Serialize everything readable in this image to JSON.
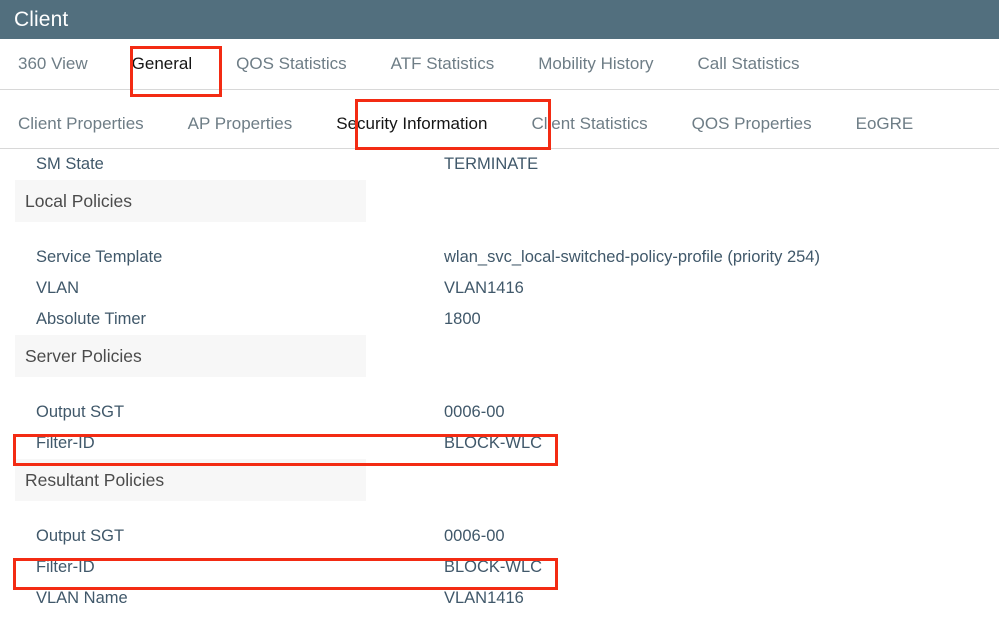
{
  "window": {
    "title": "Client",
    "header_bg": "#526f7e"
  },
  "theme": {
    "accent_blue": "#0e9fdb",
    "highlight_red": "#f32b13",
    "section_band": "#f7f7f7",
    "text_primary": "#40586a",
    "tab_inactive": "#6e7d86",
    "tab_active": "#151515"
  },
  "tabs_primary": [
    {
      "label": "360 View",
      "active": false
    },
    {
      "label": "General",
      "active": true
    },
    {
      "label": "QOS Statistics",
      "active": false
    },
    {
      "label": "ATF Statistics",
      "active": false
    },
    {
      "label": "Mobility History",
      "active": false
    },
    {
      "label": "Call Statistics",
      "active": false
    }
  ],
  "tabs_secondary": [
    {
      "label": "Client Properties",
      "active": false
    },
    {
      "label": "AP Properties",
      "active": false
    },
    {
      "label": "Security Information",
      "active": true
    },
    {
      "label": "Client Statistics",
      "active": false
    },
    {
      "label": "QOS Properties",
      "active": false
    },
    {
      "label": "EoGRE",
      "active": false
    }
  ],
  "detail_rows": [
    {
      "type": "field",
      "label": "SM State",
      "value": "TERMINATE"
    },
    {
      "type": "section",
      "label": "Local Policies"
    },
    {
      "type": "spacer"
    },
    {
      "type": "field",
      "label": "Service Template",
      "value": "wlan_svc_local-switched-policy-profile (priority 254)"
    },
    {
      "type": "field",
      "label": "VLAN",
      "value": "VLAN1416"
    },
    {
      "type": "field",
      "label": "Absolute Timer",
      "value": "1800"
    },
    {
      "type": "section",
      "label": "Server Policies"
    },
    {
      "type": "spacer"
    },
    {
      "type": "field",
      "label": "Output SGT",
      "value": "0006-00"
    },
    {
      "type": "field",
      "label": "Filter-ID",
      "value": "BLOCK-WLC",
      "highlighted": true
    },
    {
      "type": "section",
      "label": "Resultant Policies"
    },
    {
      "type": "spacer"
    },
    {
      "type": "field",
      "label": "Output SGT",
      "value": "0006-00"
    },
    {
      "type": "field",
      "label": "Filter-ID",
      "value": "BLOCK-WLC",
      "highlighted": true
    },
    {
      "type": "field",
      "label": "VLAN Name",
      "value": "VLAN1416"
    }
  ],
  "callouts": [
    {
      "name": "general-tab-callout",
      "target": "General"
    },
    {
      "name": "security-information-tab-callout",
      "target": "Security Information"
    },
    {
      "name": "server-policies-filter-id-callout",
      "target": "Filter-ID / BLOCK-WLC"
    },
    {
      "name": "resultant-policies-filter-id-callout",
      "target": "Filter-ID / BLOCK-WLC"
    }
  ]
}
